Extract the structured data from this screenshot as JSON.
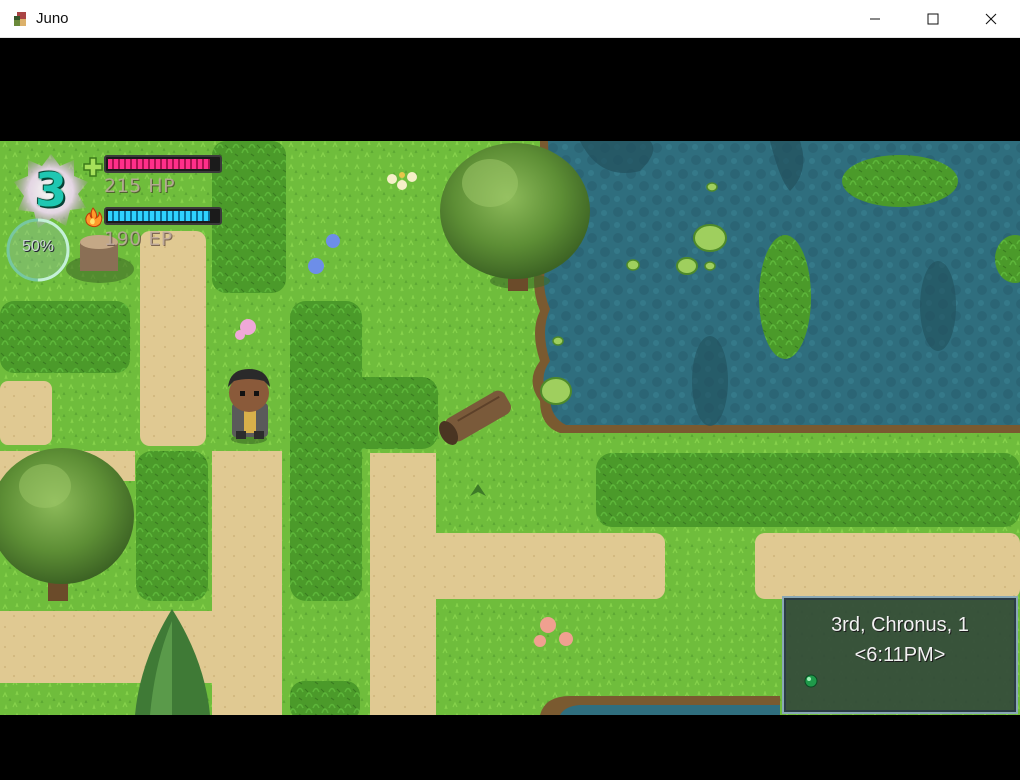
{
  "window": {
    "title": "Juno",
    "minimize_icon": "minimize-icon",
    "maximize_icon": "maximize-icon",
    "close_icon": "close-icon"
  },
  "hud": {
    "level": "3",
    "xp_percent_label": "50%",
    "xp_fraction": 0.5,
    "hp_label": "215 HP",
    "hp_fill": 0.93,
    "ep_label": "190 EP",
    "ep_fill": 0.93,
    "hp_icon": "plus-icon",
    "ep_icon": "flame-icon",
    "colors": {
      "hp": "#ff2f8a",
      "ep": "#2fd2ff",
      "level": "#1fc7b2"
    }
  },
  "clock": {
    "date": "3rd, Chronus, 1",
    "time": "<6:11PM>"
  },
  "scene": {
    "colors": {
      "grass": "#6fbd3c",
      "path": "#e2cc95",
      "hedge": "#4b9a2a",
      "water": "#2e6b7a",
      "shore": "#8a6a3a"
    }
  }
}
